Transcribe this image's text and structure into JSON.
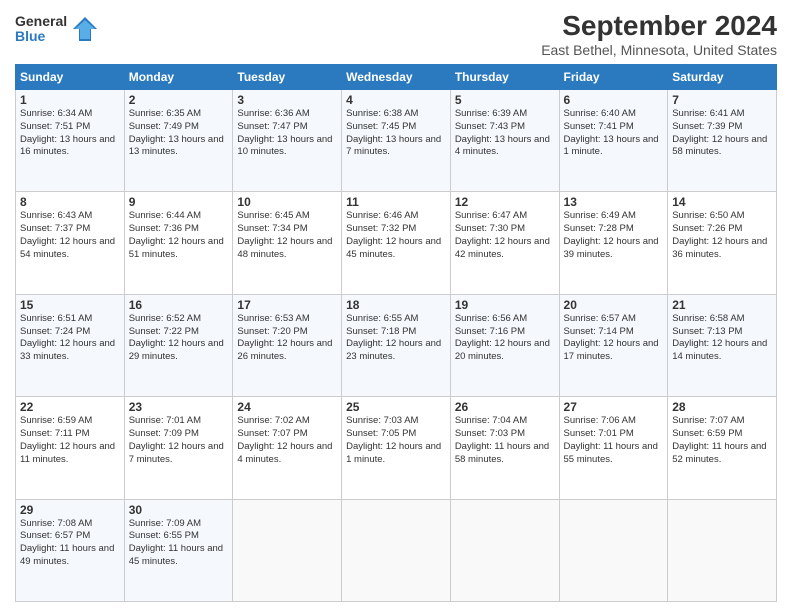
{
  "logo": {
    "general": "General",
    "blue": "Blue"
  },
  "header": {
    "title": "September 2024",
    "subtitle": "East Bethel, Minnesota, United States"
  },
  "columns": [
    "Sunday",
    "Monday",
    "Tuesday",
    "Wednesday",
    "Thursday",
    "Friday",
    "Saturday"
  ],
  "weeks": [
    [
      {
        "day": "1",
        "sunrise": "6:34 AM",
        "sunset": "7:51 PM",
        "daylight": "13 hours and 16 minutes."
      },
      {
        "day": "2",
        "sunrise": "6:35 AM",
        "sunset": "7:49 PM",
        "daylight": "13 hours and 13 minutes."
      },
      {
        "day": "3",
        "sunrise": "6:36 AM",
        "sunset": "7:47 PM",
        "daylight": "13 hours and 10 minutes."
      },
      {
        "day": "4",
        "sunrise": "6:38 AM",
        "sunset": "7:45 PM",
        "daylight": "13 hours and 7 minutes."
      },
      {
        "day": "5",
        "sunrise": "6:39 AM",
        "sunset": "7:43 PM",
        "daylight": "13 hours and 4 minutes."
      },
      {
        "day": "6",
        "sunrise": "6:40 AM",
        "sunset": "7:41 PM",
        "daylight": "13 hours and 1 minute."
      },
      {
        "day": "7",
        "sunrise": "6:41 AM",
        "sunset": "7:39 PM",
        "daylight": "12 hours and 58 minutes."
      }
    ],
    [
      {
        "day": "8",
        "sunrise": "6:43 AM",
        "sunset": "7:37 PM",
        "daylight": "12 hours and 54 minutes."
      },
      {
        "day": "9",
        "sunrise": "6:44 AM",
        "sunset": "7:36 PM",
        "daylight": "12 hours and 51 minutes."
      },
      {
        "day": "10",
        "sunrise": "6:45 AM",
        "sunset": "7:34 PM",
        "daylight": "12 hours and 48 minutes."
      },
      {
        "day": "11",
        "sunrise": "6:46 AM",
        "sunset": "7:32 PM",
        "daylight": "12 hours and 45 minutes."
      },
      {
        "day": "12",
        "sunrise": "6:47 AM",
        "sunset": "7:30 PM",
        "daylight": "12 hours and 42 minutes."
      },
      {
        "day": "13",
        "sunrise": "6:49 AM",
        "sunset": "7:28 PM",
        "daylight": "12 hours and 39 minutes."
      },
      {
        "day": "14",
        "sunrise": "6:50 AM",
        "sunset": "7:26 PM",
        "daylight": "12 hours and 36 minutes."
      }
    ],
    [
      {
        "day": "15",
        "sunrise": "6:51 AM",
        "sunset": "7:24 PM",
        "daylight": "12 hours and 33 minutes."
      },
      {
        "day": "16",
        "sunrise": "6:52 AM",
        "sunset": "7:22 PM",
        "daylight": "12 hours and 29 minutes."
      },
      {
        "day": "17",
        "sunrise": "6:53 AM",
        "sunset": "7:20 PM",
        "daylight": "12 hours and 26 minutes."
      },
      {
        "day": "18",
        "sunrise": "6:55 AM",
        "sunset": "7:18 PM",
        "daylight": "12 hours and 23 minutes."
      },
      {
        "day": "19",
        "sunrise": "6:56 AM",
        "sunset": "7:16 PM",
        "daylight": "12 hours and 20 minutes."
      },
      {
        "day": "20",
        "sunrise": "6:57 AM",
        "sunset": "7:14 PM",
        "daylight": "12 hours and 17 minutes."
      },
      {
        "day": "21",
        "sunrise": "6:58 AM",
        "sunset": "7:13 PM",
        "daylight": "12 hours and 14 minutes."
      }
    ],
    [
      {
        "day": "22",
        "sunrise": "6:59 AM",
        "sunset": "7:11 PM",
        "daylight": "12 hours and 11 minutes."
      },
      {
        "day": "23",
        "sunrise": "7:01 AM",
        "sunset": "7:09 PM",
        "daylight": "12 hours and 7 minutes."
      },
      {
        "day": "24",
        "sunrise": "7:02 AM",
        "sunset": "7:07 PM",
        "daylight": "12 hours and 4 minutes."
      },
      {
        "day": "25",
        "sunrise": "7:03 AM",
        "sunset": "7:05 PM",
        "daylight": "12 hours and 1 minute."
      },
      {
        "day": "26",
        "sunrise": "7:04 AM",
        "sunset": "7:03 PM",
        "daylight": "11 hours and 58 minutes."
      },
      {
        "day": "27",
        "sunrise": "7:06 AM",
        "sunset": "7:01 PM",
        "daylight": "11 hours and 55 minutes."
      },
      {
        "day": "28",
        "sunrise": "7:07 AM",
        "sunset": "6:59 PM",
        "daylight": "11 hours and 52 minutes."
      }
    ],
    [
      {
        "day": "29",
        "sunrise": "7:08 AM",
        "sunset": "6:57 PM",
        "daylight": "11 hours and 49 minutes."
      },
      {
        "day": "30",
        "sunrise": "7:09 AM",
        "sunset": "6:55 PM",
        "daylight": "11 hours and 45 minutes."
      },
      null,
      null,
      null,
      null,
      null
    ]
  ]
}
